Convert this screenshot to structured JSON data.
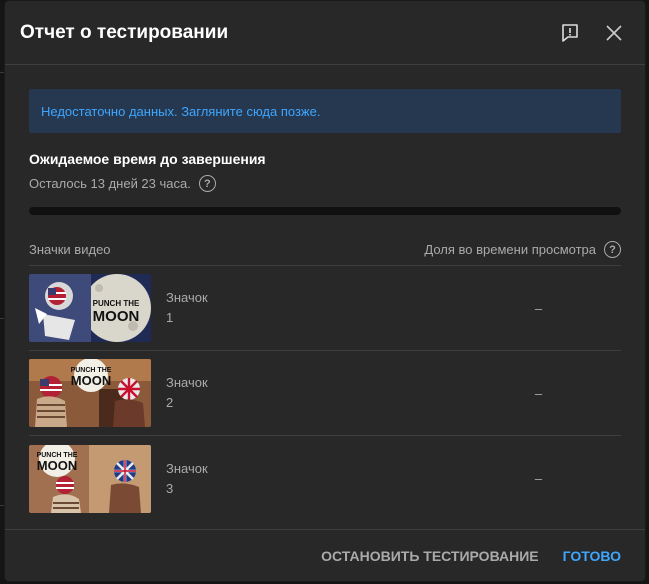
{
  "dialog": {
    "title": "Отчет о тестировании",
    "notice": "Недостаточно данных. Загляните сюда позже.",
    "eta_title": "Ожидаемое время до завершения",
    "remaining": "Осталось 13 дней 23 часа.",
    "progress_fraction": 0,
    "columns": {
      "thumbnails": "Значки видео",
      "watch_share": "Доля во времени просмотра"
    },
    "rows": [
      {
        "label": "Значок",
        "number": "1",
        "share": "–",
        "thumb_text": [
          "PUNCH THE",
          "MOON"
        ]
      },
      {
        "label": "Значок",
        "number": "2",
        "share": "–",
        "thumb_text": [
          "PUNCH THE",
          "MOON"
        ]
      },
      {
        "label": "Значок",
        "number": "3",
        "share": "–",
        "thumb_text": [
          "PUNCH THE",
          "MOON"
        ]
      }
    ],
    "buttons": {
      "stop": "ОСТАНОВИТЬ ТЕСТИРОВАНИЕ",
      "done": "ГОТОВО"
    }
  },
  "colors": {
    "accent": "#3ea6ff",
    "dialog_bg": "#282828",
    "notice_bg": "#263850"
  },
  "icons": {
    "report": "report-flag-icon",
    "close": "close-icon",
    "help": "help-circle-icon"
  }
}
